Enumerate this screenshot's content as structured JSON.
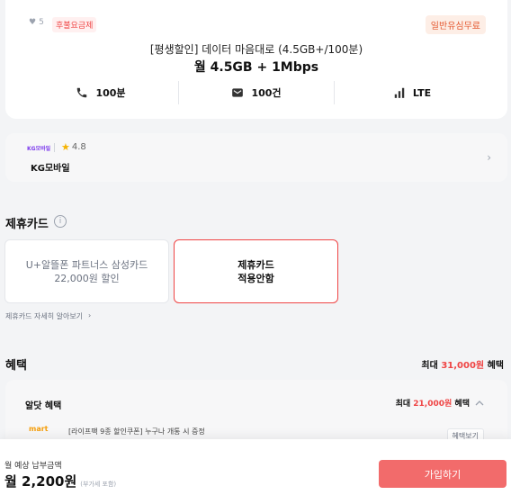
{
  "plan": {
    "likes": "5",
    "tag_left": "후불요금제",
    "tag_right": "일반유심무료",
    "name": "[평생할인] 데이터 마음대로 (4.5GB+/100분)",
    "data": "월 4.5GB + 1Mbps",
    "specs": [
      {
        "icon": "phone-icon",
        "label": "100분"
      },
      {
        "icon": "message-icon",
        "label": "100건"
      },
      {
        "icon": "signal-icon",
        "label": "LTE"
      }
    ]
  },
  "carrier": {
    "logo_text": "KG모바일",
    "rating": "4.8",
    "name": "KG모바일"
  },
  "card_section": {
    "title": "제휴카드",
    "option_a": "U+알뜰폰 파트너스 삼성카드\n22,000원 할인",
    "option_b": "제휴카드\n적용안함",
    "link": "제휴카드 자세히 알아보기"
  },
  "benefit_section": {
    "title": "혜택",
    "max_prefix": "최대 ",
    "max_amount": "31,000원",
    "max_suffix": " 혜택",
    "panel": {
      "title": "알닷 혜택",
      "max_prefix": "최대 ",
      "max_amount": "21,000원",
      "max_suffix": " 혜택",
      "item_logo": "mart",
      "item_text": "[라이프팩 9종 할인쿠폰] 누구나 개통 시 증정",
      "item_button": "혜택보기"
    }
  },
  "bottom": {
    "label": "월 예상 납부금액",
    "price": "월 2,200원",
    "vat": "(부가세 포함)",
    "cta": "가입하기"
  },
  "colors": {
    "accent": "#ef4444",
    "cta": "#f26b6b",
    "star": "#f5b301"
  }
}
